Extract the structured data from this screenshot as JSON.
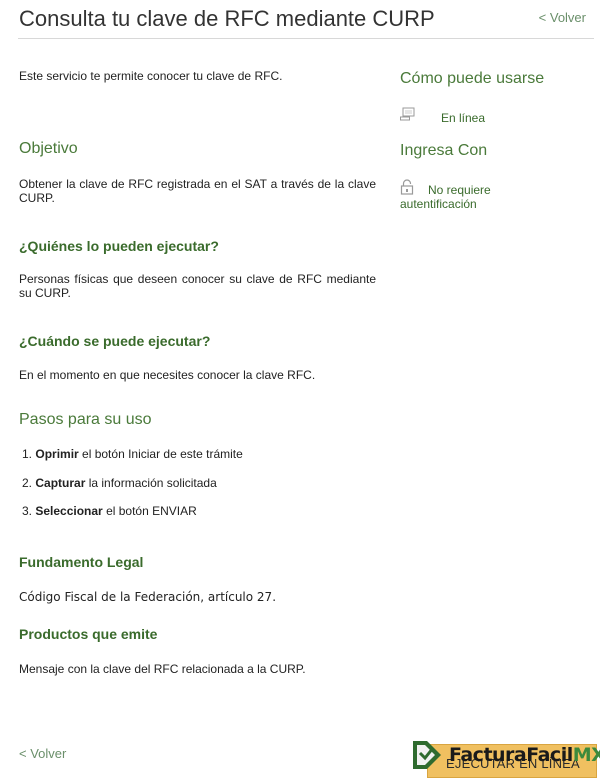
{
  "header": {
    "title": "Consulta tu clave de RFC mediante CURP",
    "back_label": "< Volver"
  },
  "intro": "Este servicio te permite conocer tu clave de RFC.",
  "objetivo": {
    "heading": "Objetivo",
    "text": "Obtener la clave de RFC registrada en el SAT a través de la clave CURP."
  },
  "quienes": {
    "heading": "¿Quiénes lo pueden ejecutar?",
    "text": "Personas físicas que deseen conocer su clave de RFC mediante su CURP."
  },
  "cuando": {
    "heading": "¿Cuándo se puede ejecutar?",
    "text": "En el momento en que necesites conocer la clave RFC."
  },
  "pasos": {
    "heading": "Pasos para su uso",
    "steps": [
      {
        "num": "1.",
        "bold": "Oprimir",
        "rest": " el botón Iniciar de este trámite"
      },
      {
        "num": "2.",
        "bold": "Capturar",
        "rest": " la información solicitada"
      },
      {
        "num": "3.",
        "bold": "Seleccionar",
        "rest": " el botón ENVIAR"
      }
    ]
  },
  "fundamento": {
    "heading": "Fundamento Legal",
    "text": "Código Fiscal de la Federación, artículo 27."
  },
  "productos": {
    "heading": "Productos que emite",
    "text": "Mensaje con la clave del RFC relacionada a la CURP."
  },
  "sidebar": {
    "como_heading": "Cómo puede usarse",
    "como_value": "En línea",
    "como_icon": "computer-icon",
    "ingresa_heading": "Ingresa Con",
    "ingresa_value": "No requiere autentificación",
    "ingresa_icon": "lock-icon"
  },
  "footer": {
    "back_label": "< Volver",
    "execute_label": "EJECUTAR EN LÍNEA"
  },
  "watermark": {
    "text_main": "FacturaFacil",
    "text_mx": "MX"
  },
  "colors": {
    "accent_green": "#4a7a3a",
    "button_bg": "#f0c060"
  }
}
